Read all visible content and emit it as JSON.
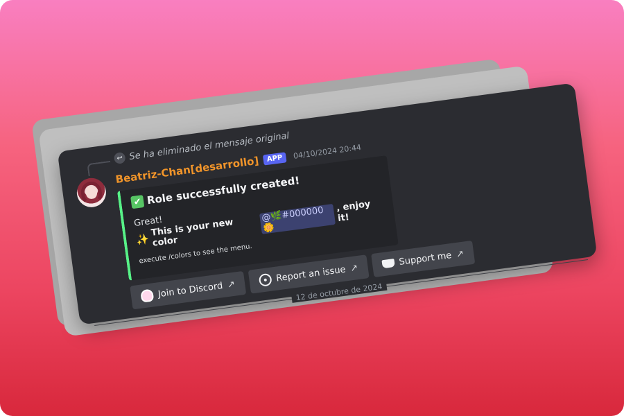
{
  "reply": {
    "text": "Se ha eliminado el mensaje original",
    "icon": "reply-arrow-icon"
  },
  "message": {
    "username": "Beatriz-Chan[desarrollo]",
    "badge": "APP",
    "timestamp": "04/10/2024 20:44",
    "username_color": "#f0942a"
  },
  "embed": {
    "accent_color": "#57f287",
    "title": "Role successfully created!",
    "greeting": "Great!",
    "color_prefix": "This is your new color",
    "mention_at": "@",
    "mention_role": "#000000",
    "color_suffix": ", enjoy it!",
    "footer_text": "execute /colors to see the menu."
  },
  "buttons": [
    {
      "label": "Join to Discord",
      "icon": "ghost-mascot-icon"
    },
    {
      "label": "Report an issue",
      "icon": "circle-dot-icon"
    },
    {
      "label": "Support me",
      "icon": "coffee-cup-icon"
    }
  ],
  "divider": {
    "date": "12 de octubre de 2024"
  },
  "colors": {
    "background_top": "#f97fc0",
    "background_bottom": "#d8283c",
    "card": "#2b2c31",
    "embed": "#232428",
    "button": "#43454c",
    "app_badge": "#5865f2"
  }
}
